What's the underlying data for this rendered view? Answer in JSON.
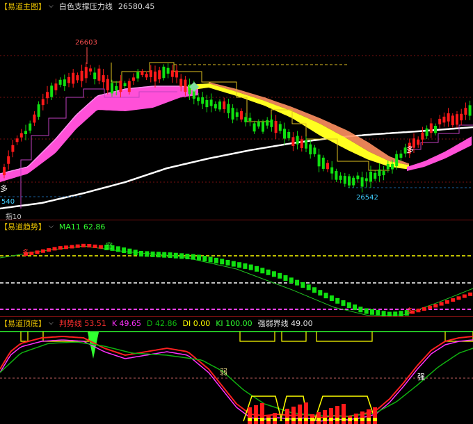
{
  "main_panel": {
    "title": "【易道主图】",
    "indicator_name": "白色支撑压力线",
    "indicator_value": "26580.45",
    "high_label": "26603",
    "low_label": "26542",
    "left_value_label": "540",
    "left_marker": "指10",
    "signal_glyph": "多"
  },
  "trend_panel": {
    "title": "【易道趋势】",
    "ma_label": "MA11",
    "ma_value": "62.86",
    "mark_duo": "多",
    "mark_kong": "空"
  },
  "bottom_panel": {
    "title": "【易道顶底】",
    "indicators": [
      {
        "label": "判势线",
        "value": "53.51",
        "color": "#ff3030"
      },
      {
        "label": "K",
        "value": "49.65",
        "color": "#ff30ff"
      },
      {
        "label": "D",
        "value": "42.86",
        "color": "#10c010"
      },
      {
        "label": "DI",
        "value": "0.00",
        "color": "#ffff00"
      },
      {
        "label": "KI",
        "value": "100.00",
        "color": "#30ff30"
      },
      {
        "label": "强弱界线",
        "value": "49.00",
        "color": "#e0e0e0"
      }
    ],
    "mark_ruo": "弱",
    "mark_qiang": "强"
  },
  "colors": {
    "up": "#ff1a1a",
    "down": "#10e010",
    "pink_band": "#ff50d8",
    "yellow_band": "#ffff20",
    "orange_band": "#ff9060",
    "white_line": "#ffffff",
    "frame": "#7a1010"
  }
}
